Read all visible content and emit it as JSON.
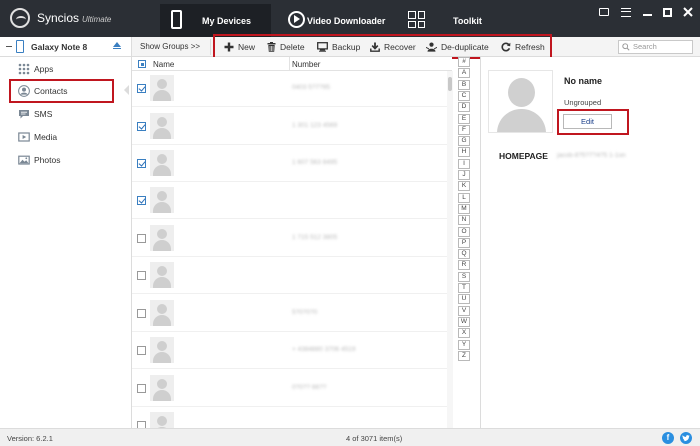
{
  "app": {
    "name": "Syncios",
    "edition": "Ultimate"
  },
  "nav": {
    "tabs": [
      {
        "label": "My Devices",
        "icon": "phone-icon",
        "active": true
      },
      {
        "label": "Video Downloader",
        "icon": "play-icon",
        "active": false
      },
      {
        "label": "Toolkit",
        "icon": "grid-icon",
        "active": false
      }
    ]
  },
  "window_controls": [
    "message-icon",
    "menu-icon",
    "minimize-icon",
    "maximize-icon",
    "close-icon"
  ],
  "device": {
    "name": "Galaxy Note 8"
  },
  "toolbar": {
    "show_groups": "Show Groups >>",
    "actions": [
      {
        "label": "New",
        "icon": "plus-icon"
      },
      {
        "label": "Delete",
        "icon": "trash-icon"
      },
      {
        "label": "Backup",
        "icon": "backup-icon"
      },
      {
        "label": "Recover",
        "icon": "recover-icon"
      },
      {
        "label": "De-duplicate",
        "icon": "deduplicate-icon"
      },
      {
        "label": "Refresh",
        "icon": "refresh-icon"
      }
    ],
    "search_placeholder": "Search"
  },
  "sidebar": {
    "items": [
      {
        "label": "Apps",
        "icon": "apps-icon",
        "active": false
      },
      {
        "label": "Contacts",
        "icon": "contacts-icon",
        "active": true
      },
      {
        "label": "SMS",
        "icon": "sms-icon",
        "active": false
      },
      {
        "label": "Media",
        "icon": "media-icon",
        "active": false
      },
      {
        "label": "Photos",
        "icon": "photos-icon",
        "active": false
      }
    ]
  },
  "contacts": {
    "columns": [
      "Name",
      "Number"
    ],
    "rows": [
      {
        "checked": true,
        "number": "0403 5?7?95"
      },
      {
        "checked": true,
        "number": "1 301 123 4569"
      },
      {
        "checked": true,
        "number": "1 607 563 8495"
      },
      {
        "checked": true,
        "number": ""
      },
      {
        "checked": false,
        "number": "1 715 512 3805"
      },
      {
        "checked": false,
        "number": ""
      },
      {
        "checked": false,
        "number": "5?0?0?0"
      },
      {
        "checked": false,
        "number": "+ 4384880 3706 4519"
      },
      {
        "checked": false,
        "number": "0?0?? 66??"
      },
      {
        "checked": false,
        "number": ""
      }
    ]
  },
  "alphabet": [
    "#",
    "A",
    "B",
    "C",
    "D",
    "E",
    "F",
    "G",
    "H",
    "I",
    "J",
    "K",
    "L",
    "M",
    "N",
    "O",
    "P",
    "Q",
    "R",
    "S",
    "T",
    "U",
    "V",
    "W",
    "X",
    "Y",
    "Z"
  ],
  "detail": {
    "name": "No name",
    "group": "Ungrouped",
    "edit_label": "Edit",
    "homepage_label": "HOMEPAGE",
    "homepage_value": "jacob-8?5?7?4?5 1-1on"
  },
  "status": {
    "version": "Version: 6.2.1",
    "count": "4 of 3071 item(s)"
  },
  "social": [
    "facebook-icon",
    "twitter-icon"
  ]
}
